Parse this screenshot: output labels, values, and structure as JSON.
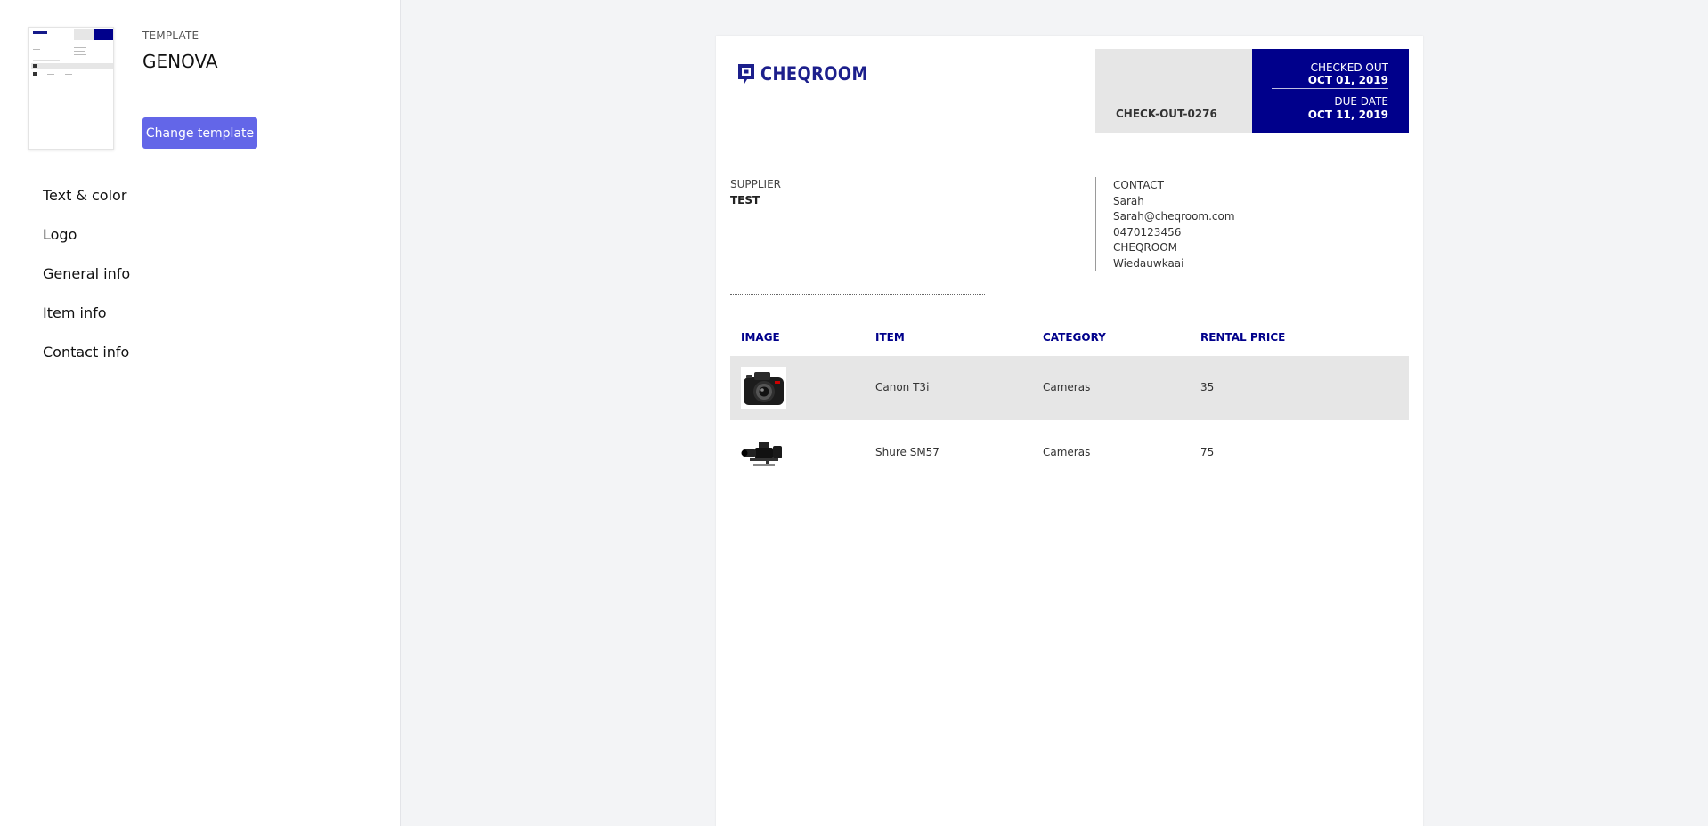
{
  "sidebar": {
    "template_label": "TEMPLATE",
    "template_name": "GENOVA",
    "change_template_label": "Change template",
    "menu": [
      {
        "label": "Text & color"
      },
      {
        "label": "Logo"
      },
      {
        "label": "General info"
      },
      {
        "label": "Item info"
      },
      {
        "label": "Contact info"
      }
    ]
  },
  "document": {
    "logo_text": "CHEQROOM",
    "checkout_code": "CHECK-OUT-0276",
    "checked_out_label": "CHECKED OUT",
    "checked_out_date": "OCT 01, 2019",
    "due_date_label": "DUE DATE",
    "due_date": "OCT 11, 2019",
    "supplier_label": "SUPPLIER",
    "supplier_value": "TEST",
    "contact_label": "CONTACT",
    "contact_lines": [
      "Sarah",
      "Sarah@cheqroom.com",
      "0470123456",
      "CHEQROOM",
      "Wiedauwkaai"
    ],
    "table": {
      "headers": [
        "IMAGE",
        "ITEM",
        "CATEGORY",
        "RENTAL PRICE"
      ],
      "rows": [
        {
          "image_icon": "camera-icon",
          "item": "Canon T3i",
          "category": "Cameras",
          "rental_price": "35"
        },
        {
          "image_icon": "video-camera-icon",
          "item": "Shure SM57",
          "category": "Cameras",
          "rental_price": "75"
        }
      ]
    }
  },
  "colors": {
    "accent_button": "#6366e8",
    "header_blue": "#00008b",
    "header_gray": "#e6e6e6",
    "logo": "#1c1f8c"
  }
}
